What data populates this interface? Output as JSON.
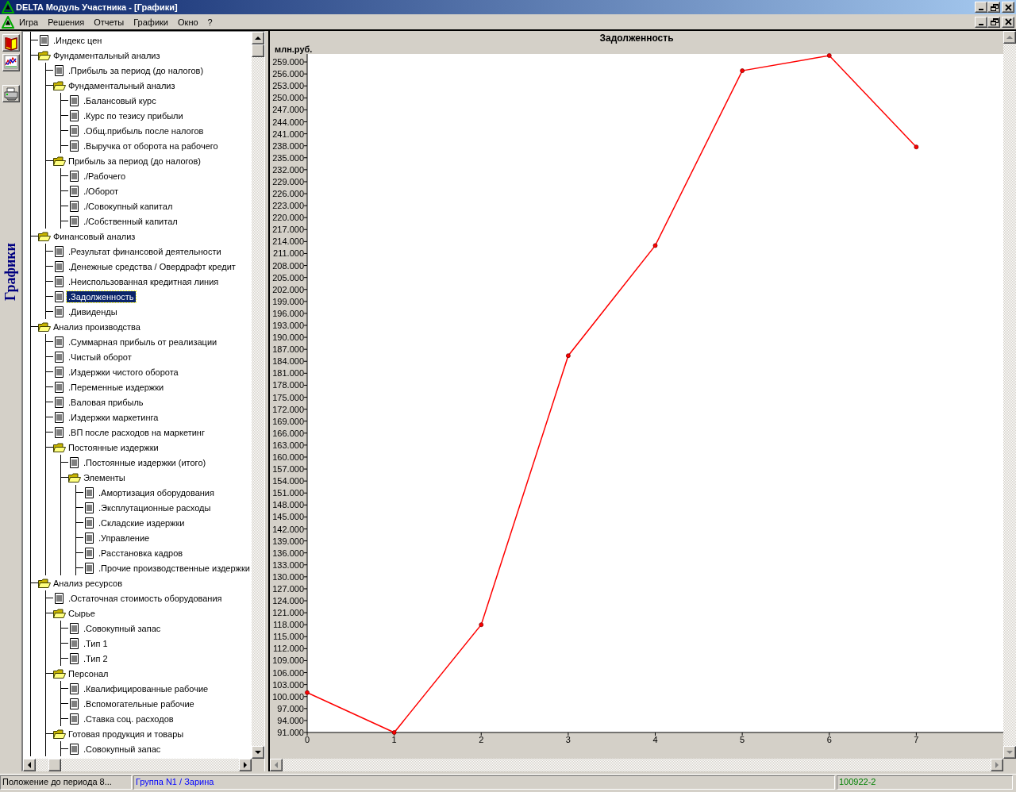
{
  "window": {
    "title": "DELTA Модуль Участника - [Графики]"
  },
  "menu": [
    "Игра",
    "Решения",
    "Отчеты",
    "Графики",
    "Окно",
    "?"
  ],
  "side_toolbar": {
    "label": "Графики"
  },
  "tree": [
    {
      "label": ".Индекс цен",
      "kind": "doc",
      "selected": false
    },
    {
      "label": "Фундаментальный анализ",
      "kind": "folder",
      "selected": false,
      "children": [
        {
          "label": ".Прибыль за период (до налогов)",
          "kind": "doc",
          "selected": false
        },
        {
          "label": "Фундаментальный анализ",
          "kind": "folder",
          "selected": false,
          "children": [
            {
              "label": ".Балансовый курс",
              "kind": "doc",
              "selected": false
            },
            {
              "label": ".Курс по тезису прибыли",
              "kind": "doc",
              "selected": false
            },
            {
              "label": ".Общ.прибыль после налогов",
              "kind": "doc",
              "selected": false
            },
            {
              "label": ".Выручка от оборота на рабочего",
              "kind": "doc",
              "selected": false
            }
          ]
        },
        {
          "label": "Прибыль за период (до налогов)",
          "kind": "folder",
          "selected": false,
          "children": [
            {
              "label": "./Рабочего",
              "kind": "doc",
              "selected": false
            },
            {
              "label": "./Оборот",
              "kind": "doc",
              "selected": false
            },
            {
              "label": "./Совокупный капитал",
              "kind": "doc",
              "selected": false
            },
            {
              "label": "./Собственный капитал",
              "kind": "doc",
              "selected": false
            }
          ]
        }
      ]
    },
    {
      "label": "Финансовый анализ",
      "kind": "folder",
      "selected": false,
      "children": [
        {
          "label": ".Результат финансовой деятельности",
          "kind": "doc",
          "selected": false
        },
        {
          "label": ".Денежные средства / Овердрафт кредит",
          "kind": "doc",
          "selected": false
        },
        {
          "label": ".Неиспользованная кредитная линия",
          "kind": "doc",
          "selected": false
        },
        {
          "label": ".Задолженность",
          "kind": "doc",
          "selected": true
        },
        {
          "label": ".Дивиденды",
          "kind": "doc",
          "selected": false
        }
      ]
    },
    {
      "label": "Анализ производства",
      "kind": "folder",
      "selected": false,
      "children": [
        {
          "label": ".Суммарная прибыль от реализации",
          "kind": "doc",
          "selected": false
        },
        {
          "label": ".Чистый оборот",
          "kind": "doc",
          "selected": false
        },
        {
          "label": ".Издержки чистого оборота",
          "kind": "doc",
          "selected": false
        },
        {
          "label": ".Переменные издержки",
          "kind": "doc",
          "selected": false
        },
        {
          "label": ".Валовая прибыль",
          "kind": "doc",
          "selected": false
        },
        {
          "label": ".Издержки маркетинга",
          "kind": "doc",
          "selected": false
        },
        {
          "label": ".ВП после расходов на маркетинг",
          "kind": "doc",
          "selected": false
        },
        {
          "label": "Постоянные издержки",
          "kind": "folder",
          "selected": false,
          "children": [
            {
              "label": ".Постоянные издержки (итого)",
              "kind": "doc",
              "selected": false
            },
            {
              "label": "Элементы",
              "kind": "folder",
              "selected": false,
              "children": [
                {
                  "label": ".Амортизация оборудования",
                  "kind": "doc",
                  "selected": false
                },
                {
                  "label": ".Эксплутационные расходы",
                  "kind": "doc",
                  "selected": false
                },
                {
                  "label": ".Складские издержки",
                  "kind": "doc",
                  "selected": false
                },
                {
                  "label": ".Управление",
                  "kind": "doc",
                  "selected": false
                },
                {
                  "label": ".Расстановка кадров",
                  "kind": "doc",
                  "selected": false
                },
                {
                  "label": ".Прочие производственные издержки",
                  "kind": "doc",
                  "selected": false
                }
              ]
            }
          ]
        }
      ]
    },
    {
      "label": "Анализ ресурсов",
      "kind": "folder",
      "selected": false,
      "children": [
        {
          "label": ".Остаточная стоимость оборудования",
          "kind": "doc",
          "selected": false
        },
        {
          "label": "Сырье",
          "kind": "folder",
          "selected": false,
          "children": [
            {
              "label": ".Совокупный запас",
              "kind": "doc",
              "selected": false
            },
            {
              "label": ".Тип 1",
              "kind": "doc",
              "selected": false
            },
            {
              "label": ".Тип 2",
              "kind": "doc",
              "selected": false
            }
          ]
        },
        {
          "label": "Персонал",
          "kind": "folder",
          "selected": false,
          "children": [
            {
              "label": ".Квалифицированные рабочие",
              "kind": "doc",
              "selected": false
            },
            {
              "label": ".Вспомогательные рабочие",
              "kind": "doc",
              "selected": false
            },
            {
              "label": ".Ставка соц. расходов",
              "kind": "doc",
              "selected": false
            }
          ]
        },
        {
          "label": "Готовая продукция и товары",
          "kind": "folder",
          "selected": false,
          "children": [
            {
              "label": ".Совокупный запас",
              "kind": "doc",
              "selected": false
            }
          ]
        }
      ]
    }
  ],
  "chart": {
    "chart_data": {
      "type": "line",
      "title": "Задолженность",
      "ylabel": "млн.руб.",
      "x": [
        0,
        1,
        2,
        3,
        4,
        5,
        6,
        7
      ],
      "series": [
        {
          "color": "#ff0000",
          "marker": "circle",
          "values": [
            101000,
            91000,
            118000,
            185400,
            213000,
            256800,
            260600,
            237700
          ]
        }
      ],
      "xlim": [
        0,
        8
      ],
      "ylim": [
        91000,
        261000
      ],
      "xticks": [
        0,
        1,
        2,
        3,
        4,
        5,
        6,
        7
      ],
      "yticks": [
        {
          "value": 91000,
          "label": "91.000"
        },
        {
          "value": 94000,
          "label": "94.000"
        },
        {
          "value": 97000,
          "label": "97.000"
        },
        {
          "value": 100000,
          "label": "100.000"
        },
        {
          "value": 103000,
          "label": "103.000"
        },
        {
          "value": 106000,
          "label": "106.000"
        },
        {
          "value": 109000,
          "label": "109.000"
        },
        {
          "value": 112000,
          "label": "112.000"
        },
        {
          "value": 115000,
          "label": "115.000"
        },
        {
          "value": 118000,
          "label": "118.000"
        },
        {
          "value": 121000,
          "label": "121.000"
        },
        {
          "value": 124000,
          "label": "124.000"
        },
        {
          "value": 127000,
          "label": "127.000"
        },
        {
          "value": 130000,
          "label": "130.000"
        },
        {
          "value": 133000,
          "label": "133.000"
        },
        {
          "value": 136000,
          "label": "136.000"
        },
        {
          "value": 139000,
          "label": "139.000"
        },
        {
          "value": 142000,
          "label": "142.000"
        },
        {
          "value": 145000,
          "label": "145.000"
        },
        {
          "value": 148000,
          "label": "148.000"
        },
        {
          "value": 151000,
          "label": "151.000"
        },
        {
          "value": 154000,
          "label": "154.000"
        },
        {
          "value": 157000,
          "label": "157.000"
        },
        {
          "value": 160000,
          "label": "160.000"
        },
        {
          "value": 163000,
          "label": "163.000"
        },
        {
          "value": 166000,
          "label": "166.000"
        },
        {
          "value": 169000,
          "label": "169.000"
        },
        {
          "value": 172000,
          "label": "172.000"
        },
        {
          "value": 175000,
          "label": "175.000"
        },
        {
          "value": 178000,
          "label": "178.000"
        },
        {
          "value": 181000,
          "label": "181.000"
        },
        {
          "value": 184000,
          "label": "184.000"
        },
        {
          "value": 187000,
          "label": "187.000"
        },
        {
          "value": 190000,
          "label": "190.000"
        },
        {
          "value": 193000,
          "label": "193.000"
        },
        {
          "value": 196000,
          "label": "196.000"
        },
        {
          "value": 199000,
          "label": "199.000"
        },
        {
          "value": 202000,
          "label": "202.000"
        },
        {
          "value": 205000,
          "label": "205.000"
        },
        {
          "value": 208000,
          "label": "208.000"
        },
        {
          "value": 211000,
          "label": "211.000"
        },
        {
          "value": 214000,
          "label": "214.000"
        },
        {
          "value": 217000,
          "label": "217.000"
        },
        {
          "value": 220000,
          "label": "220.000"
        },
        {
          "value": 223000,
          "label": "223.000"
        },
        {
          "value": 226000,
          "label": "226.000"
        },
        {
          "value": 229000,
          "label": "229.000"
        },
        {
          "value": 232000,
          "label": "232.000"
        },
        {
          "value": 235000,
          "label": "235.000"
        },
        {
          "value": 238000,
          "label": "238.000"
        },
        {
          "value": 241000,
          "label": "241.000"
        },
        {
          "value": 244000,
          "label": "244.000"
        },
        {
          "value": 247000,
          "label": "247.000"
        },
        {
          "value": 250000,
          "label": "250.000"
        },
        {
          "value": 253000,
          "label": "253.000"
        },
        {
          "value": 256000,
          "label": "256.000"
        },
        {
          "value": 259000,
          "label": "259.000"
        }
      ]
    }
  },
  "status_bar": [
    {
      "text": "Положение до периода 8...",
      "color": "#000000"
    },
    {
      "text": "Группа N1 / Зарина",
      "color": "#0000ff"
    },
    {
      "text": "100922-2",
      "color": "#008000"
    }
  ]
}
